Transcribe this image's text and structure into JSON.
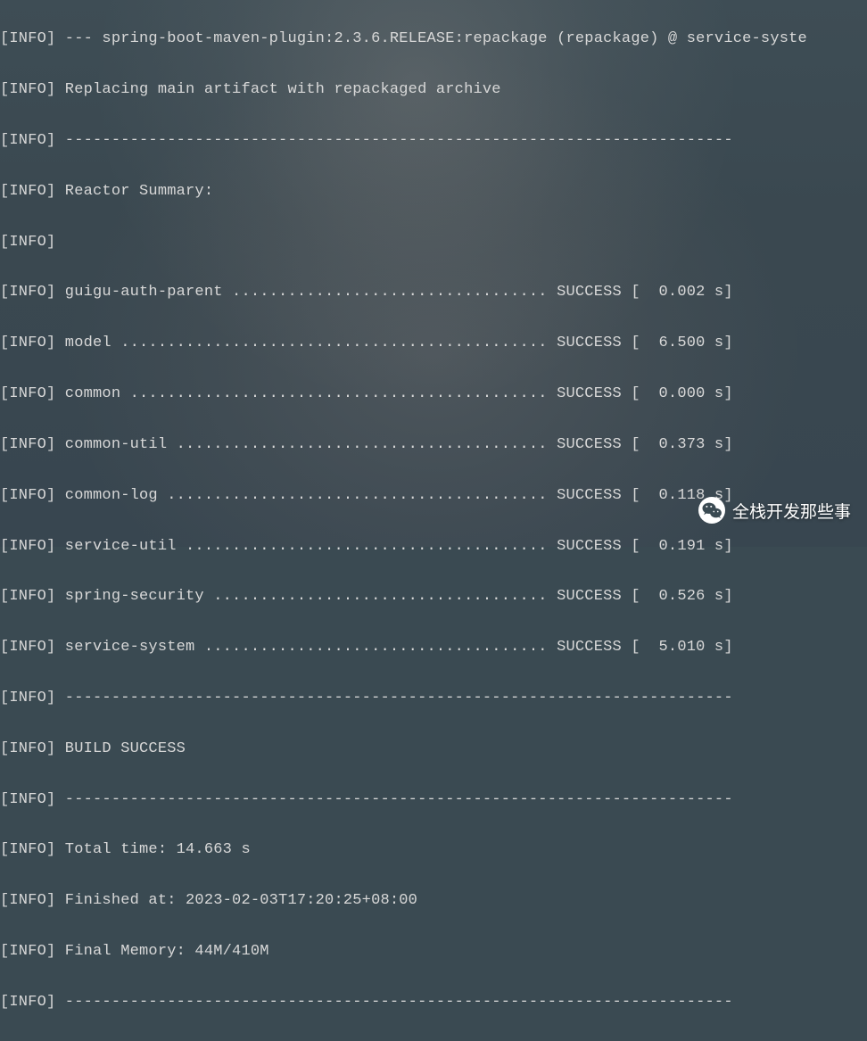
{
  "prefix": "[INFO]",
  "lines": {
    "l0": "[INFO] --- spring-boot-maven-plugin:2.3.6.RELEASE:repackage (repackage) @ service-syste",
    "l1": "[INFO] Replacing main artifact with repackaged archive",
    "l2": "[INFO] ------------------------------------------------------------------------",
    "l3": "[INFO] Reactor Summary:",
    "l4": "[INFO]",
    "l5": "[INFO] guigu-auth-parent .................................. SUCCESS [  0.002 s]",
    "l6": "[INFO] model .............................................. SUCCESS [  6.500 s]",
    "l7": "[INFO] common ............................................. SUCCESS [  0.000 s]",
    "l8": "[INFO] common-util ........................................ SUCCESS [  0.373 s]",
    "l9": "[INFO] common-log ......................................... SUCCESS [  0.118 s]",
    "l10": "[INFO] service-util ....................................... SUCCESS [  0.191 s]",
    "l11": "[INFO] spring-security .................................... SUCCESS [  0.526 s]",
    "l12": "[INFO] service-system ..................................... SUCCESS [  5.010 s]",
    "l13": "[INFO] ------------------------------------------------------------------------",
    "l14": "[INFO] BUILD SUCCESS",
    "l15": "[INFO] ------------------------------------------------------------------------",
    "l16": "[INFO] Total time: 14.663 s",
    "l17": "[INFO] Finished at: 2023-02-03T17:20:25+08:00",
    "l18": "[INFO] Final Memory: 44M/410M",
    "l19": "[INFO] ------------------------------------------------------------------------"
  },
  "reactor": {
    "modules": [
      {
        "name": "guigu-auth-parent",
        "status": "SUCCESS",
        "time": "0.002 s"
      },
      {
        "name": "model",
        "status": "SUCCESS",
        "time": "6.500 s"
      },
      {
        "name": "common",
        "status": "SUCCESS",
        "time": "0.000 s"
      },
      {
        "name": "common-util",
        "status": "SUCCESS",
        "time": "0.373 s"
      },
      {
        "name": "common-log",
        "status": "SUCCESS",
        "time": "0.118 s"
      },
      {
        "name": "service-util",
        "status": "SUCCESS",
        "time": "0.191 s"
      },
      {
        "name": "spring-security",
        "status": "SUCCESS",
        "time": "0.526 s"
      },
      {
        "name": "service-system",
        "status": "SUCCESS",
        "time": "5.010 s"
      }
    ],
    "build_status": "BUILD SUCCESS",
    "total_time": "14.663 s",
    "finished_at": "2023-02-03T17:20:25+08:00",
    "final_memory": "44M/410M"
  },
  "watermark": {
    "text": "全栈开发那些事"
  }
}
